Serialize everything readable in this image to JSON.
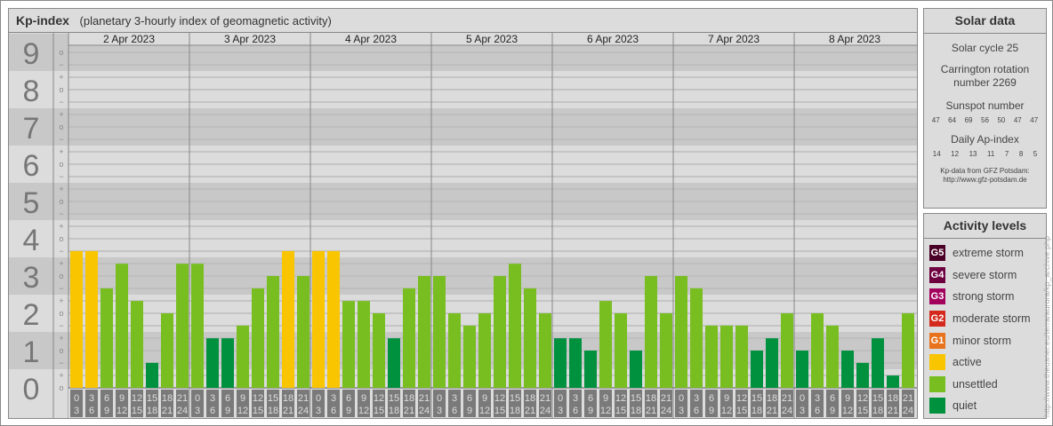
{
  "header": {
    "title": "Kp-index",
    "subtitle": "(planetary 3-hourly index of geomagnetic activity)"
  },
  "chart_data": {
    "type": "bar",
    "title": "Kp-index",
    "ylim": [
      0,
      9
    ],
    "y_ticks": [
      "0",
      "1",
      "2",
      "3",
      "4",
      "5",
      "6",
      "7",
      "8",
      "9"
    ],
    "third_marks": [
      "o",
      "+",
      "−"
    ],
    "days": [
      "2 Apr 2023",
      "3 Apr 2023",
      "4 Apr 2023",
      "5 Apr 2023",
      "6 Apr 2023",
      "7 Apr 2023",
      "8 Apr 2023"
    ],
    "intervals": [
      [
        "0",
        "3"
      ],
      [
        "3",
        "6"
      ],
      [
        "6",
        "9"
      ],
      [
        "9",
        "12"
      ],
      [
        "12",
        "15"
      ],
      [
        "15",
        "18"
      ],
      [
        "18",
        "21"
      ],
      [
        "21",
        "24"
      ]
    ],
    "values": [
      [
        3.67,
        3.67,
        2.67,
        3.33,
        2.33,
        0.67,
        2.0,
        3.33
      ],
      [
        3.33,
        1.33,
        1.33,
        1.67,
        2.67,
        3.0,
        3.67,
        3.0
      ],
      [
        3.67,
        3.67,
        2.33,
        2.33,
        2.0,
        1.33,
        2.67,
        3.0
      ],
      [
        3.0,
        2.0,
        1.67,
        2.0,
        3.0,
        3.33,
        2.67,
        2.0
      ],
      [
        1.33,
        1.33,
        1.0,
        2.33,
        2.0,
        1.0,
        3.0,
        2.0
      ],
      [
        3.0,
        2.67,
        1.67,
        1.67,
        1.67,
        1.0,
        1.33,
        2.0
      ],
      [
        1.0,
        2.0,
        1.67,
        1.0,
        0.67,
        1.33,
        0.33,
        2.0
      ]
    ],
    "colors": {
      "quiet": "#00913f",
      "unsettled": "#78be20",
      "active": "#f9c400"
    }
  },
  "solar": {
    "title": "Solar data",
    "cycle": "Solar cycle 25",
    "carrington": "Carrington rotation number 2269",
    "sunspot_label": "Sunspot number",
    "sunspots": [
      "47",
      "64",
      "69",
      "56",
      "50",
      "47",
      "47"
    ],
    "ap_label": "Daily Ap-index",
    "ap": [
      "14",
      "12",
      "13",
      "11",
      "7",
      "8",
      "5"
    ],
    "credit1": "Kp-data from GFZ Potsdam:",
    "credit2": "http://www.gfz-potsdam.de"
  },
  "legend": {
    "title": "Activity levels",
    "items": [
      {
        "badge": "G5",
        "label": "extreme storm",
        "color": "#4a0026"
      },
      {
        "badge": "G4",
        "label": "severe storm",
        "color": "#6e0040"
      },
      {
        "badge": "G3",
        "label": "strong storm",
        "color": "#a3005e"
      },
      {
        "badge": "G2",
        "label": "moderate storm",
        "color": "#d4291c"
      },
      {
        "badge": "G1",
        "label": "minor storm",
        "color": "#e8731c"
      },
      {
        "badge": "",
        "label": "active",
        "color": "#f9c400"
      },
      {
        "badge": "",
        "label": "unsettled",
        "color": "#78be20"
      },
      {
        "badge": "",
        "label": "quiet",
        "color": "#00913f"
      }
    ]
  },
  "watermark": "http://www.theusner.eu/terra/aurora/kp_archive.php"
}
